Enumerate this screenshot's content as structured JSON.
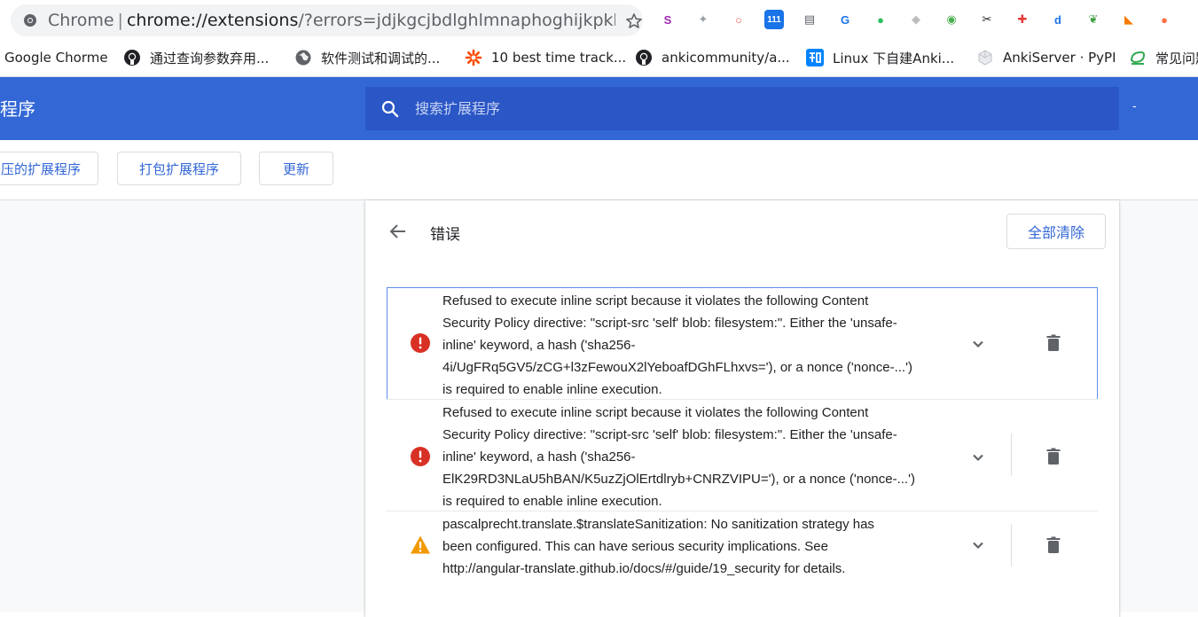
{
  "omnibox": {
    "site": "Chrome",
    "separator": "|",
    "url_host": "chrome://extensions",
    "url_rest": "/?errors=jdjkgcjbdlghlmnaphoghijkpkho..."
  },
  "extensions": [
    {
      "name": "bookmark-ext-icon",
      "glyph": "S",
      "color": "#9c27b0"
    },
    {
      "name": "pin-icon",
      "glyph": "✦",
      "color": "#9aa0a6"
    },
    {
      "name": "circle-ext-icon",
      "glyph": "○",
      "color": "#ef5350"
    },
    {
      "name": "speed-ext-icon",
      "glyph": "111",
      "color": "#1a73e8"
    },
    {
      "name": "reader-ext-icon",
      "glyph": "▤",
      "color": "#5f6368"
    },
    {
      "name": "translate-ext-icon",
      "glyph": "G",
      "color": "#1a73e8"
    },
    {
      "name": "evernote-icon",
      "glyph": "●",
      "color": "#2dbe60"
    },
    {
      "name": "shield-ext-icon",
      "glyph": "◆",
      "color": "#bdbdbd"
    },
    {
      "name": "globe-ext-icon",
      "glyph": "◉",
      "color": "#4caf50"
    },
    {
      "name": "scissors-icon",
      "glyph": "✂",
      "color": "#202124"
    },
    {
      "name": "plus-ext-icon",
      "glyph": "✚",
      "color": "#e53935"
    },
    {
      "name": "d-ext-icon",
      "glyph": "d",
      "color": "#1a73e8"
    },
    {
      "name": "leaf-ext-icon",
      "glyph": "❦",
      "color": "#43a047"
    },
    {
      "name": "rss-icon",
      "glyph": "◣",
      "color": "#f57c00"
    },
    {
      "name": "orange-ext-icon",
      "glyph": "●",
      "color": "#ff7043"
    }
  ],
  "bookmarks": [
    {
      "label": "Google Chorme",
      "icon": "none"
    },
    {
      "label": "通过查询参数弃用...",
      "icon": "github-icon"
    },
    {
      "label": "软件测试和调试的...",
      "icon": "globe-icon"
    },
    {
      "label": "10 best time track...",
      "icon": "zapier-icon"
    },
    {
      "label": "ankicommunity/a...",
      "icon": "github-icon"
    },
    {
      "label": "Linux 下自建Anki...",
      "icon": "zhihu-icon"
    },
    {
      "label": "AnkiServer · PyPI",
      "icon": "pypi-icon"
    },
    {
      "label": "常见问题",
      "icon": "leaf-icon"
    }
  ],
  "header": {
    "title": "程序",
    "search_placeholder": "搜索扩展程序",
    "dash": "-"
  },
  "toolbar": {
    "load_unpacked": "压的扩展程序",
    "pack": "打包扩展程序",
    "update": "更新"
  },
  "errors_page": {
    "title": "错误",
    "clear_all": "全部清除",
    "items": [
      {
        "level": "error",
        "message": "Refused to execute inline script because it violates the following Content\nSecurity Policy directive: \"script-src 'self' blob: filesystem:\". Either the 'unsafe-\ninline' keyword, a hash ('sha256-\n4i/UgFRq5GV5/zCG+l3zFewouX2lYeboafDGhFLhxvs='), or a nonce ('nonce-...')\nis required to enable inline execution."
      },
      {
        "level": "error",
        "message": "Refused to execute inline script because it violates the following Content\nSecurity Policy directive: \"script-src 'self' blob: filesystem:\". Either the 'unsafe-\ninline' keyword, a hash ('sha256-\nElK29RD3NLaU5hBAN/K5uzZjOlErtdlryb+CNRZVIPU='), or a nonce ('nonce-...')\nis required to enable inline execution."
      },
      {
        "level": "warning",
        "message": "pascalprecht.translate.$translateSanitization: No sanitization strategy has\nbeen configured. This can have serious security implications. See\nhttp://angular-translate.github.io/docs/#/guide/19_security for details."
      }
    ]
  },
  "colors": {
    "header_blue": "#3367d6",
    "search_blue": "#2a56c6",
    "error_red": "#d93025",
    "warning_orange": "#f29900",
    "link_blue": "#3367d6"
  }
}
